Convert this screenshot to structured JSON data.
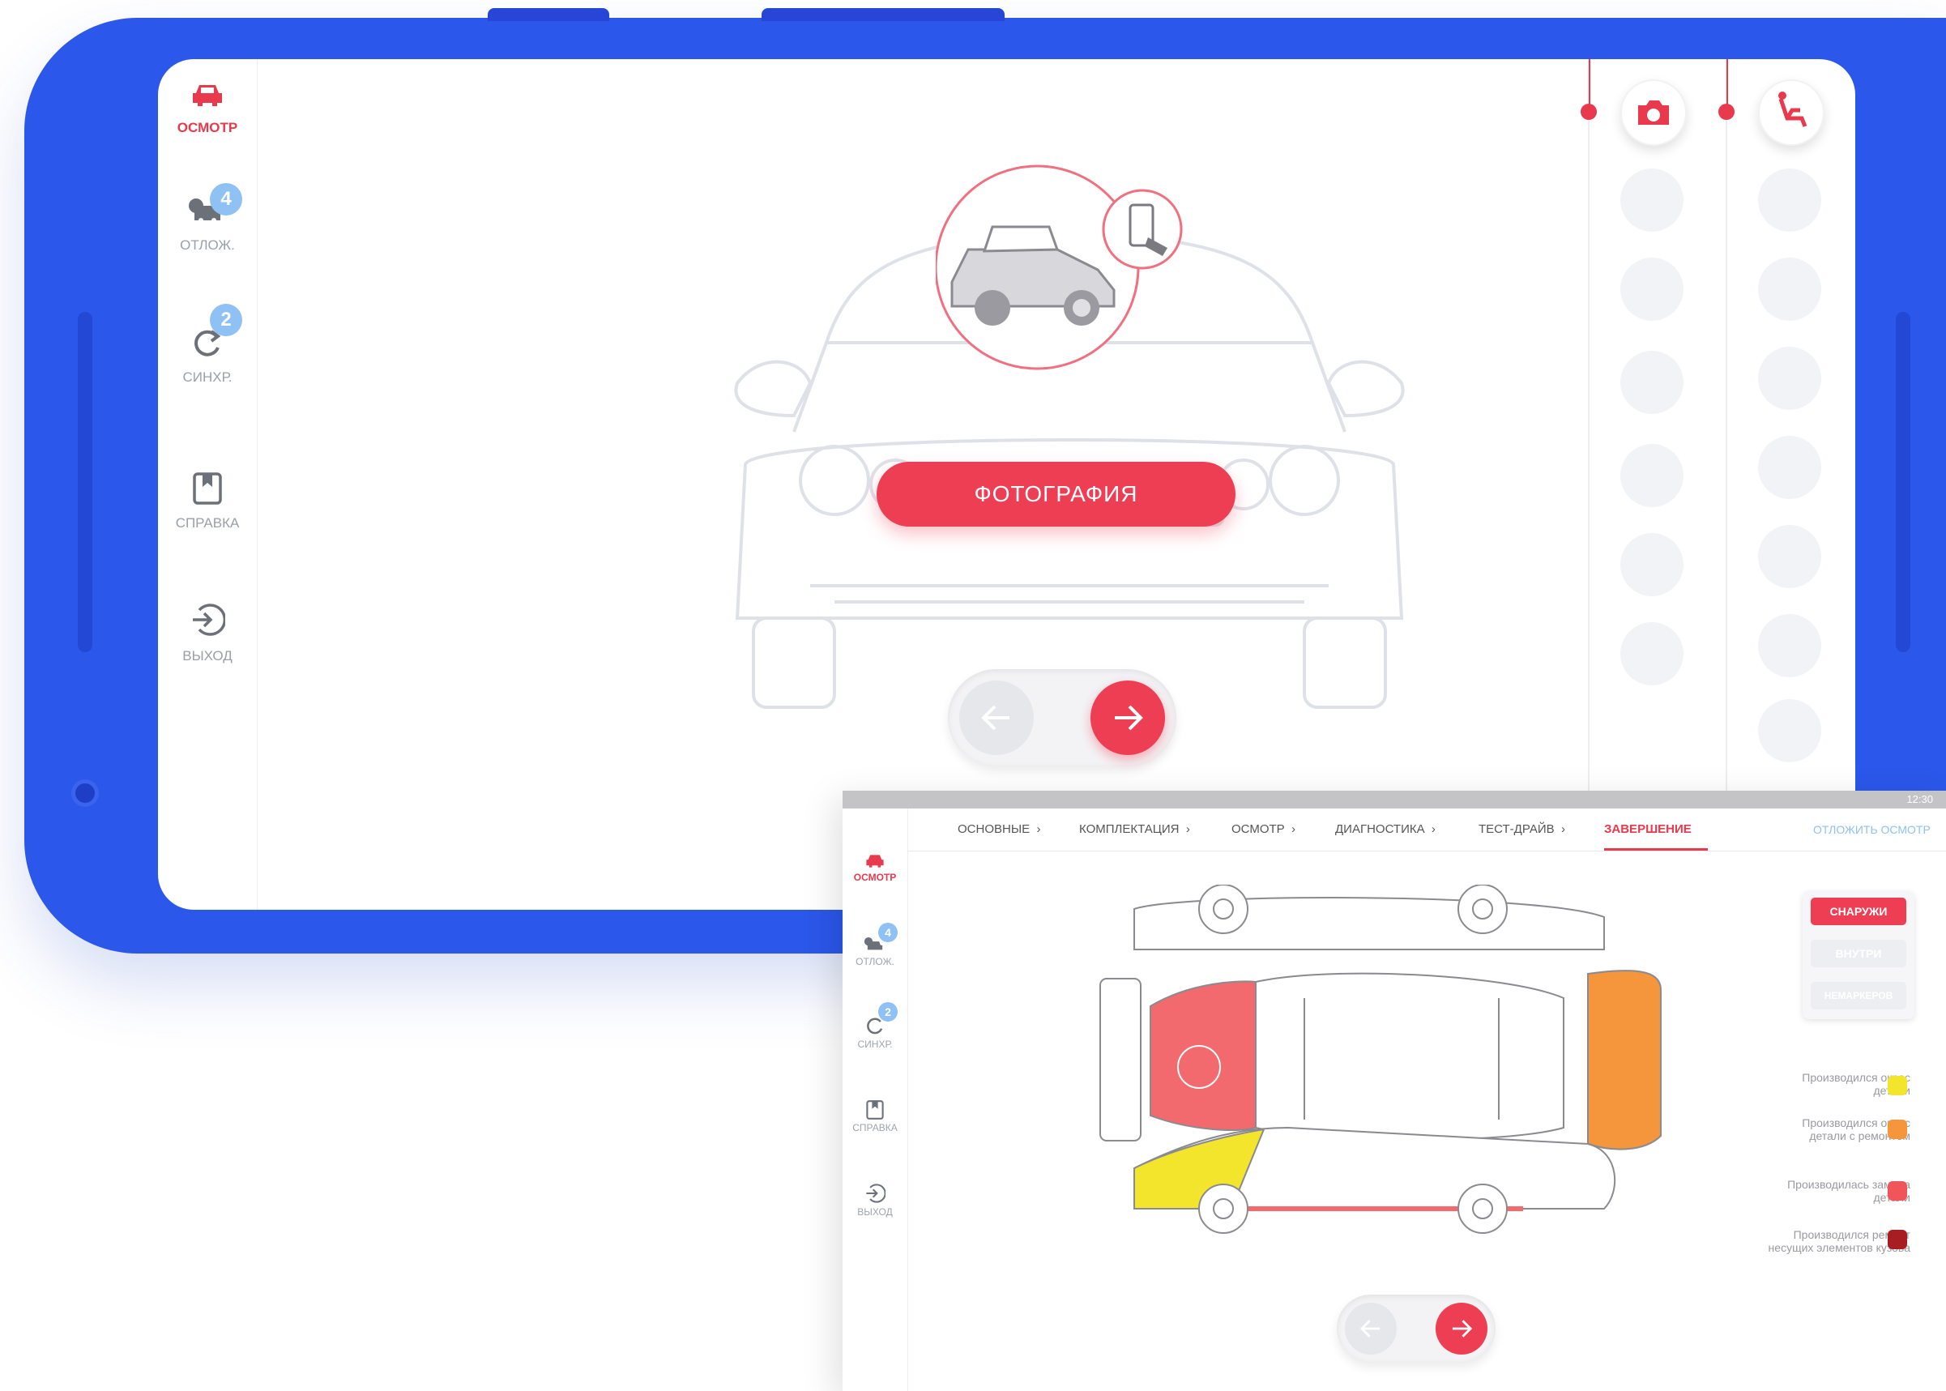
{
  "sidebar": {
    "items": [
      {
        "label": "ОСМОТР",
        "active": true
      },
      {
        "label": "ОТЛОЖ.",
        "badge": "4"
      },
      {
        "label": "СИНХР.",
        "badge": "2"
      },
      {
        "label": "СПРАВКА"
      },
      {
        "label": "ВЫХОД"
      }
    ]
  },
  "main": {
    "action_button": "ФОТОГРАФИЯ"
  },
  "tablet": {
    "status": {
      "time": "12:30"
    },
    "tabs": [
      "ОСНОВНЫЕ",
      "КОМПЛЕКТАЦИЯ",
      "ОСМОТР",
      "ДИАГНОСТИКА",
      "ТЕСТ-ДРАЙВ",
      "ЗАВЕРШЕНИЕ"
    ],
    "active_tab": "ЗАВЕРШЕНИЕ",
    "postpone_link": "ОТЛОЖИТЬ ОСМОТР",
    "sidebar": [
      "ОСМОТР",
      "ОТЛОЖ.",
      "СИНХР.",
      "СПРАВКА",
      "ВЫХОД"
    ],
    "badges": [
      "4",
      "2"
    ],
    "filters": [
      "СНАРУЖИ",
      "ВНУТРИ",
      "НЕМАРКЕРОВ"
    ],
    "legend": [
      {
        "text": "Производился окрас детали",
        "color": "#f2e52c"
      },
      {
        "text": "Производился окрас детали с ремонтом",
        "color": "#f5963c"
      },
      {
        "text": "Производилась замена детали",
        "color": "#f0555c"
      },
      {
        "text": "Производился ремонт несущих элементов кузова",
        "color": "#a81d22"
      }
    ]
  },
  "colors": {
    "accent": "#ed3e53",
    "phone": "#2b57ea",
    "muted": "#9aa0a8"
  }
}
